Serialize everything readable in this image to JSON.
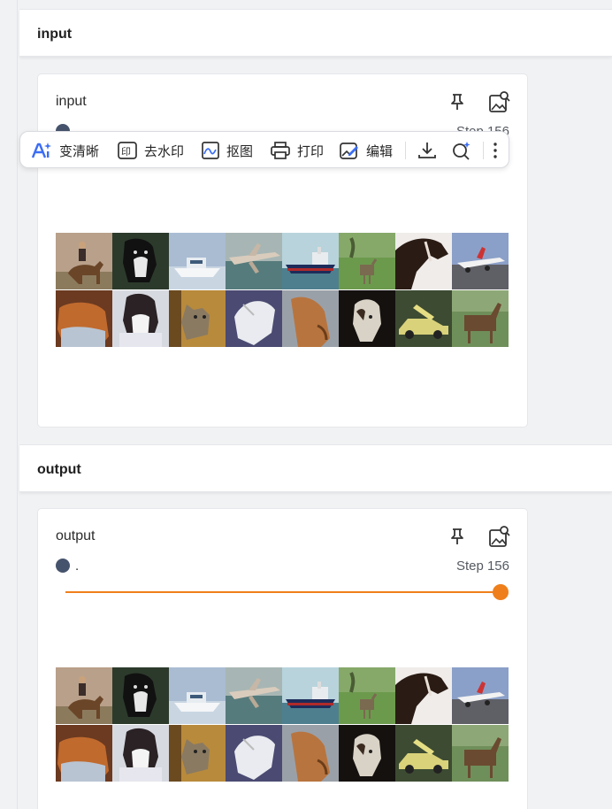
{
  "sections": [
    {
      "header": "input",
      "card_title": "input",
      "legend_label": "",
      "step_label": "Step 156"
    },
    {
      "header": "output",
      "card_title": "output",
      "legend_label": ".",
      "step_label": "Step 156",
      "slider_fraction": 1.0
    }
  ],
  "toolbar": {
    "enhance": "变清晰",
    "watermark": "去水印",
    "cutout": "抠图",
    "print": "打印",
    "edit": "编辑"
  },
  "colors": {
    "accent_orange": "#ef7f1a",
    "legend_dot": "#46536c",
    "toolbar_blue": "#3b6df5"
  },
  "images": [
    "horse-with-rider",
    "dog",
    "boat",
    "airplane",
    "ship",
    "deer",
    "horse",
    "airplane",
    "cat",
    "dog",
    "cat",
    "dog",
    "dog",
    "dog",
    "car",
    "horse"
  ]
}
